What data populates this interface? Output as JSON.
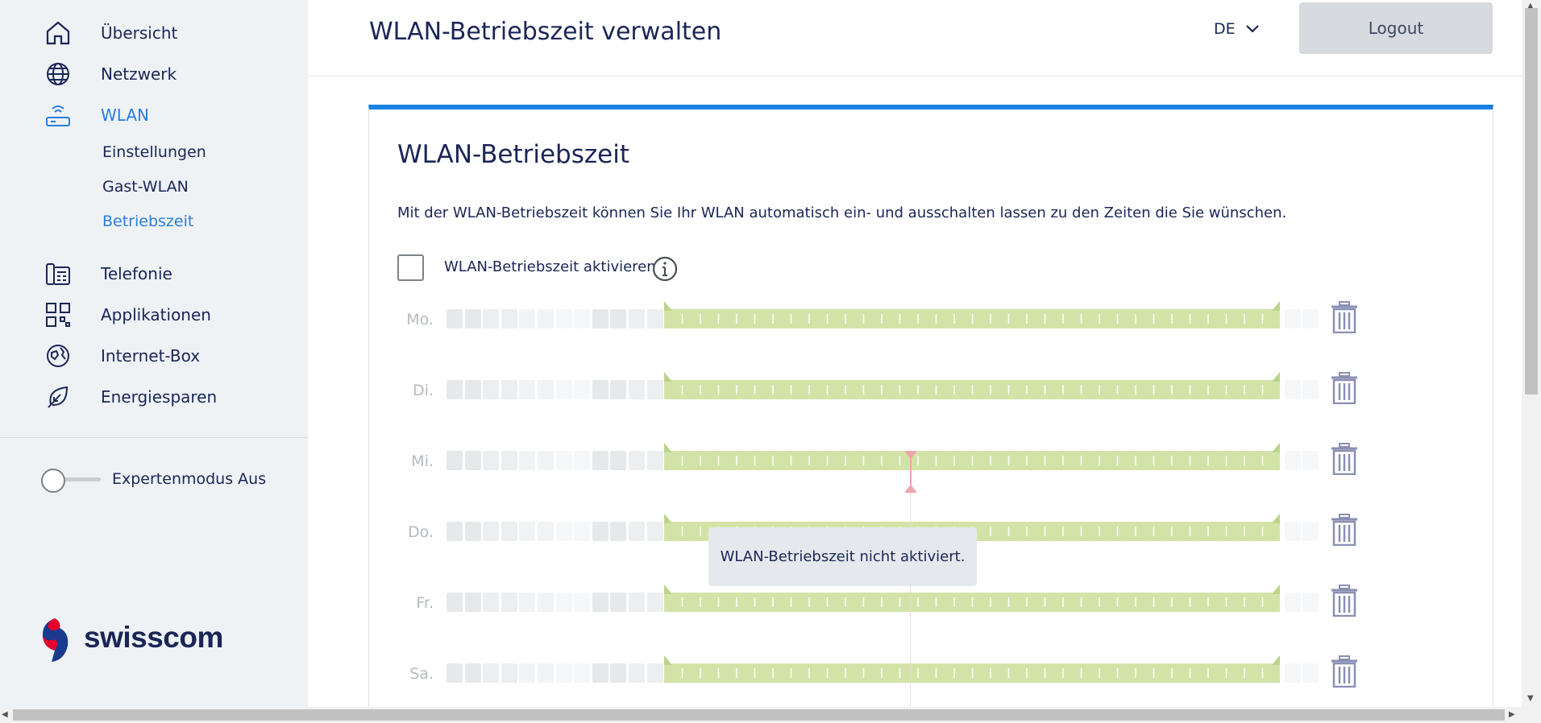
{
  "sidebar": {
    "nav": [
      {
        "label": "Übersicht",
        "icon": "home-icon"
      },
      {
        "label": "Netzwerk",
        "icon": "globe-icon"
      },
      {
        "label": "WLAN",
        "icon": "wlan-router-icon",
        "active": true
      },
      {
        "label": "Telefonie",
        "icon": "phone-icon"
      },
      {
        "label": "Applikationen",
        "icon": "apps-grid-icon"
      },
      {
        "label": "Internet-Box",
        "icon": "internet-box-icon"
      },
      {
        "label": "Energiesparen",
        "icon": "leaf-icon"
      }
    ],
    "wlan_sub": [
      {
        "label": "Einstellungen"
      },
      {
        "label": "Gast-WLAN"
      },
      {
        "label": "Betriebszeit",
        "active": true
      }
    ],
    "expert_mode_label": "Expertenmodus Aus",
    "expert_mode_on": false,
    "logo_text": "swisscom"
  },
  "header": {
    "title": "WLAN-Betriebszeit verwalten",
    "language": "DE",
    "logout_label": "Logout"
  },
  "card": {
    "title": "WLAN-Betriebszeit",
    "description": "Mit der WLAN-Betriebszeit können Sie Ihr WLAN automatisch ein- und ausschalten lassen zu den Zeiten die Sie wünschen.",
    "activate_label": "WLAN-Betriebszeit aktivieren",
    "activate_checked": false,
    "days": [
      {
        "label": "Mo."
      },
      {
        "label": "Di."
      },
      {
        "label": "Mi."
      },
      {
        "label": "Do."
      },
      {
        "label": "Fr."
      },
      {
        "label": "Sa."
      }
    ],
    "tooltip": "WLAN-Betriebszeit nicht aktiviert."
  },
  "colors": {
    "accent": "#1a81e0",
    "active_nav": "#2a7de1",
    "text": "#1b2557",
    "bar": "#d3e3a8",
    "bar_edge": "#bcd48a",
    "marker": "#f0a4ab"
  }
}
